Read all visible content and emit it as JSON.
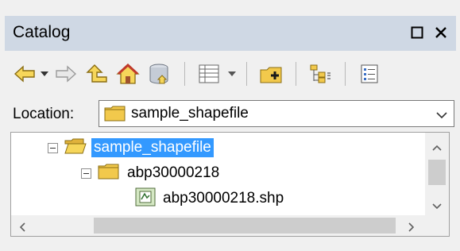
{
  "window": {
    "title": "Catalog",
    "buttons": [
      {
        "name": "maximize-button",
        "icon": "square-icon"
      },
      {
        "name": "close-button",
        "icon": "close-icon",
        "label": "✕"
      }
    ]
  },
  "toolbar": {
    "items": [
      "back-icon",
      "back-dropdown-icon",
      "forward-icon",
      "up-one-level-icon",
      "home-icon",
      "default-geodatabase-icon",
      "views-icon",
      "views-dropdown-icon",
      "connect-to-folder-icon",
      "toggle-contents-panel-icon",
      "options-icon"
    ]
  },
  "location": {
    "label": "Location:",
    "value": "sample_shapefile",
    "icon": "folder-icon"
  },
  "tree": {
    "nodes": [
      {
        "label": "sample_shapefile",
        "icon": "open-folder-icon",
        "expanded": true,
        "selected": true,
        "level": 0
      },
      {
        "label": "abp30000218",
        "icon": "folder-icon",
        "expanded": true,
        "selected": false,
        "level": 1
      },
      {
        "label": "abp30000218.shp",
        "icon": "shapefile-icon",
        "selected": false,
        "level": 2
      }
    ]
  },
  "colors": {
    "titlebar_bg": "#cfd8e4",
    "selection": "#3399ff",
    "folder": "#f2c94c"
  }
}
